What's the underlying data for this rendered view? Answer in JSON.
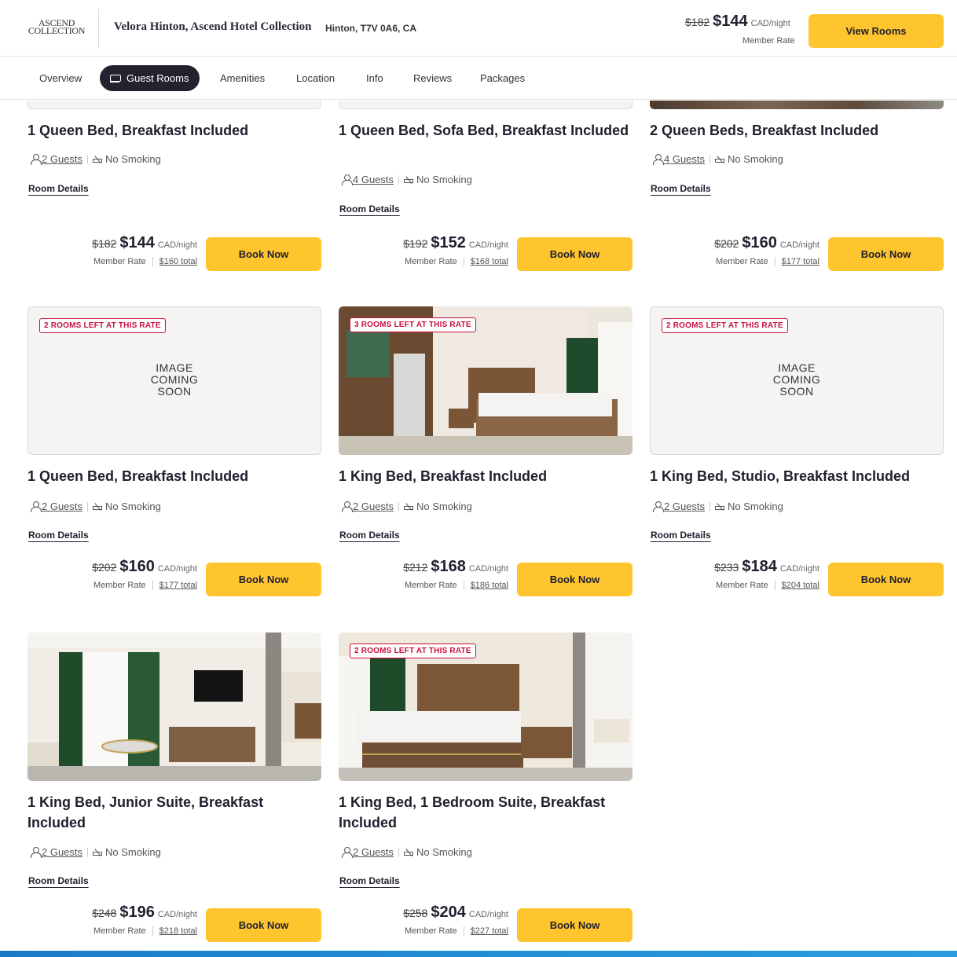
{
  "header": {
    "logo_line1": "ASCEND",
    "logo_line2": "COLLECTION",
    "hotel_name": "Velora Hinton, Ascend Hotel Collection",
    "location": "Hinton, T7V 0A6, CA",
    "was_price": "$182",
    "price": "$144",
    "unit": "CAD/night",
    "member_rate": "Member Rate",
    "cta": "View Rooms"
  },
  "tabs": [
    "Overview",
    "Guest Rooms",
    "Amenities",
    "Location",
    "Info",
    "Reviews",
    "Packages"
  ],
  "active_tab": "Guest Rooms",
  "labels": {
    "room_details": "Room Details",
    "no_smoking": "No Smoking",
    "member_rate": "Member Rate",
    "book_now": "Book Now",
    "unit": "CAD/night",
    "image_soon": "IMAGE COMING SOON"
  },
  "rooms": [
    {
      "title": "1 Queen Bed, Breakfast Included",
      "guests": "2 Guests",
      "was": "$182",
      "price": "$144",
      "total": "$160 total",
      "badge": "",
      "image": "none"
    },
    {
      "title": "1 Queen Bed, Sofa Bed, Breakfast Included",
      "guests": "4 Guests",
      "was": "$192",
      "price": "$152",
      "total": "$168 total",
      "badge": "",
      "image": "none"
    },
    {
      "title": "2 Queen Beds, Breakfast Included",
      "guests": "4 Guests",
      "was": "$202",
      "price": "$160",
      "total": "$177 total",
      "badge": "",
      "image": "photo"
    },
    {
      "title": "1 Queen Bed, Breakfast Included",
      "guests": "2 Guests",
      "was": "$202",
      "price": "$160",
      "total": "$177 total",
      "badge": "2 ROOMS LEFT AT THIS RATE",
      "image": "coming-soon"
    },
    {
      "title": "1 King Bed, Breakfast Included",
      "guests": "2 Guests",
      "was": "$212",
      "price": "$168",
      "total": "$186 total",
      "badge": "3 ROOMS LEFT AT THIS RATE",
      "image": "photo-bed-kitchen"
    },
    {
      "title": "1 King Bed, Studio, Breakfast Included",
      "guests": "2 Guests",
      "was": "$233",
      "price": "$184",
      "total": "$204 total",
      "badge": "2 ROOMS LEFT AT THIS RATE",
      "image": "coming-soon"
    },
    {
      "title": "1 King Bed, Junior Suite, Breakfast Included",
      "guests": "2 Guests",
      "was": "$248",
      "price": "$196",
      "total": "$218 total",
      "badge": "",
      "image": "photo-living"
    },
    {
      "title": "1 King Bed, 1 Bedroom Suite, Breakfast Included",
      "guests": "2 Guests",
      "was": "$258",
      "price": "$204",
      "total": "$227 total",
      "badge": "2 ROOMS LEFT AT THIS RATE",
      "image": "photo-bed"
    }
  ],
  "colors": {
    "accent": "#fec52e",
    "badge": "#c8103e",
    "active_tab": "#23222f"
  }
}
